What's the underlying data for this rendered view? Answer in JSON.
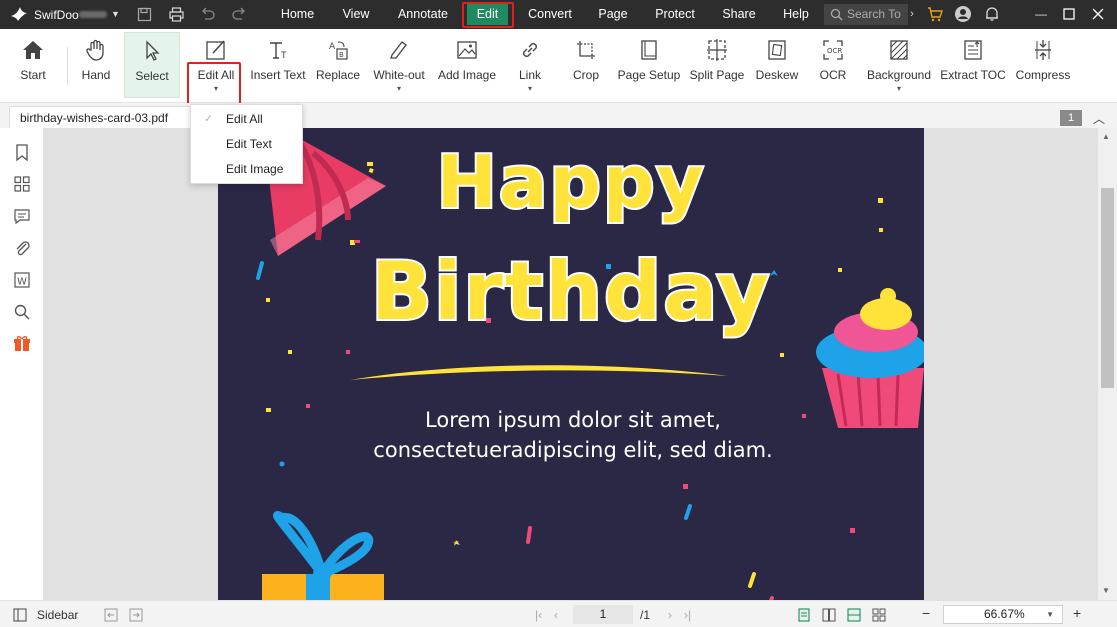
{
  "app": {
    "name": "SwifDoo",
    "menus": [
      "Home",
      "View",
      "Annotate",
      "Edit",
      "Convert",
      "Page",
      "Protect",
      "Share",
      "Help"
    ],
    "active_menu": "Edit",
    "search_placeholder": "Search To"
  },
  "toolbar": {
    "start": "Start",
    "hand": "Hand",
    "select": "Select",
    "edit_all": "Edit All",
    "insert_text": "Insert Text",
    "replace": "Replace",
    "white_out": "White-out",
    "add_image": "Add Image",
    "link": "Link",
    "crop": "Crop",
    "page_setup": "Page Setup",
    "split_page": "Split Page",
    "deskew": "Deskew",
    "ocr": "OCR",
    "background": "Background",
    "extract_toc": "Extract TOC",
    "compress": "Compress"
  },
  "tab": {
    "filename": "birthday-wishes-card-03.pdf",
    "page_chip": "1"
  },
  "dropdown": {
    "items": [
      "Edit All",
      "Edit Text",
      "Edit Image"
    ],
    "checked": "Edit All"
  },
  "document": {
    "title_line1": "Happy",
    "title_line2": "Birthday",
    "body_line1": "Lorem ipsum dolor sit amet,",
    "body_line2": "consectetueradipiscing elit, sed diam."
  },
  "statusbar": {
    "sidebar_label": "Sidebar",
    "current_page": "1",
    "total_pages": "/1",
    "zoom": "66.67%"
  },
  "colors": {
    "titlebar": "#2d2d2d",
    "accent_green": "#1e8a5e",
    "highlight_red": "#e0221f",
    "card_background": "#2a2845",
    "title_yellow": "#ffe23a"
  }
}
